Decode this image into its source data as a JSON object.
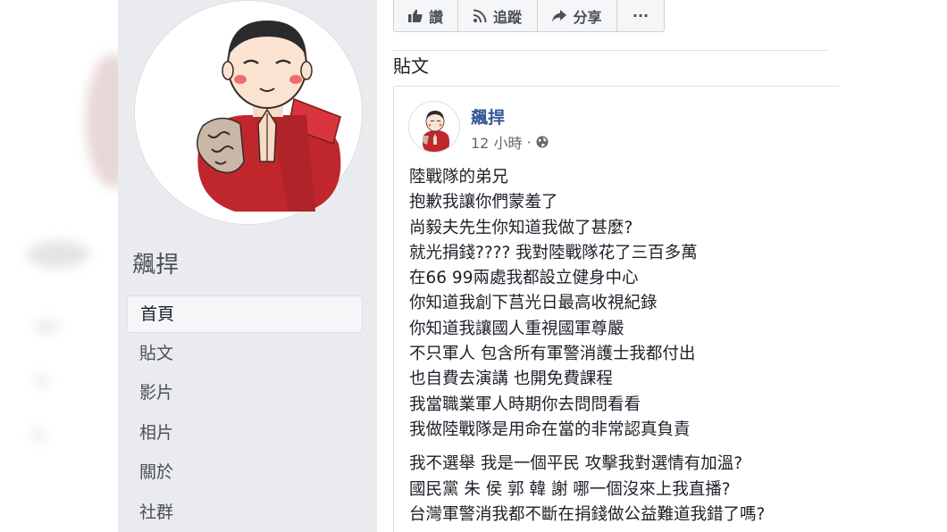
{
  "page": {
    "name": "飆捍"
  },
  "sidebar": {
    "nav_items": [
      {
        "label": "首頁",
        "active": true
      },
      {
        "label": "貼文",
        "active": false
      },
      {
        "label": "影片",
        "active": false
      },
      {
        "label": "相片",
        "active": false
      },
      {
        "label": "關於",
        "active": false
      },
      {
        "label": "社群",
        "active": false
      }
    ]
  },
  "actions": {
    "like": {
      "label": "讚",
      "icon": "thumbs-up-icon"
    },
    "follow": {
      "label": "追蹤",
      "icon": "rss-icon"
    },
    "share": {
      "label": "分享",
      "icon": "share-arrow-icon"
    },
    "more": {
      "label": "···",
      "icon": "more-dots-icon"
    }
  },
  "section": {
    "title": "貼文"
  },
  "post": {
    "author": "飆捍",
    "time": "12 小時",
    "separator": "·",
    "privacy_icon": "globe-icon",
    "paragraph1": [
      "陸戰隊的弟兄",
      "抱歉我讓你們蒙羞了",
      "尚毅夫先生你知道我做了甚麼?",
      "就光捐錢???? 我對陸戰隊花了三百多萬",
      "在66 99兩處我都設立健身中心",
      "你知道我創下莒光日最高收視紀錄",
      "你知道我讓國人重視國軍尊嚴",
      "不只軍人 包含所有軍警消護士我都付出",
      "也自費去演講 也開免費課程",
      "我當職業軍人時期你去問問看看",
      "我做陸戰隊是用命在當的非常認真負責"
    ],
    "paragraph2": [
      "我不選舉 我是一個平民 攻擊我對選情有加溫?",
      "國民黨 朱 侯 郭 韓 謝 哪一個沒來上我直播?",
      "台灣軍警消我都不斷在捐錢做公益難道我錯了嗎?"
    ]
  },
  "colors": {
    "sidebar_bg": "#e9ebee",
    "link_blue": "#365899",
    "robe_red": "#c0272d"
  }
}
